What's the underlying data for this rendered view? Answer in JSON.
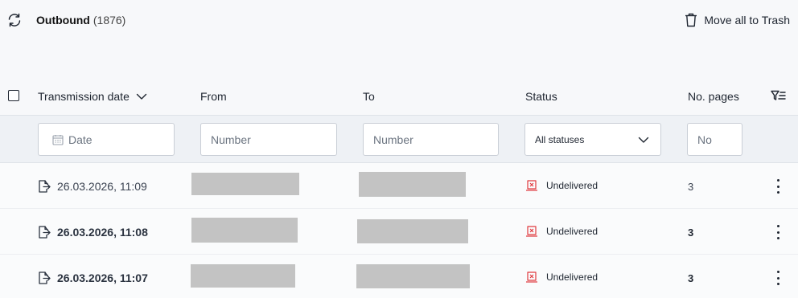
{
  "toolbar": {
    "title": "Outbound",
    "count": "(1876)",
    "trash_label": "Move all to Trash"
  },
  "columns": {
    "date": "Transmission date",
    "from": "From",
    "to": "To",
    "status": "Status",
    "pages": "No. pages"
  },
  "filters": {
    "date_placeholder": "Date",
    "from_placeholder": "Number",
    "to_placeholder": "Number",
    "status_value": "All statuses",
    "pages_placeholder": "No"
  },
  "rows": [
    {
      "date": "26.03.2026, 11:09",
      "status": "Undelivered",
      "pages": "3",
      "unread": false
    },
    {
      "date": "26.03.2026, 11:08",
      "status": "Undelivered",
      "pages": "3",
      "unread": true
    },
    {
      "date": "26.03.2026, 11:07",
      "status": "Undelivered",
      "pages": "3",
      "unread": true
    }
  ],
  "colors": {
    "status_error": "#e0393e",
    "redaction": "#c3c3c3"
  }
}
